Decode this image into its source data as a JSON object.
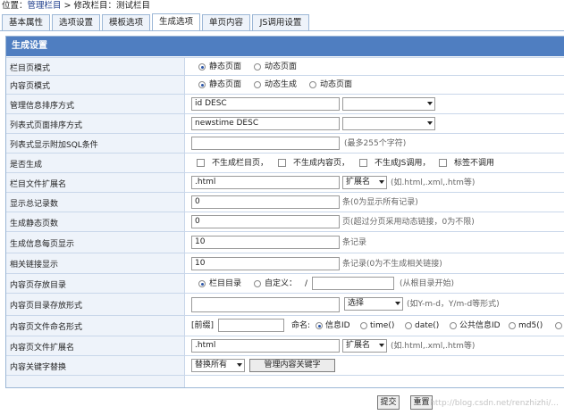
{
  "breadcrumb": {
    "prefix": "位置：",
    "link": "管理栏目",
    "sep": " > ",
    "current": "修改栏目：测试栏目"
  },
  "tabs": [
    "基本属性",
    "选项设置",
    "模板选项",
    "生成选项",
    "单页内容",
    "JS调用设置"
  ],
  "active_tab": "生成选项",
  "panel_title": "生成设置",
  "rows": {
    "list_mode": {
      "label": "栏目页模式",
      "opt1": "静态页面",
      "opt2": "动态页面",
      "selected": "静态页面"
    },
    "content_mode": {
      "label": "内容页模式",
      "opt1": "静态页面",
      "opt2": "动态生成",
      "opt3": "动态页面",
      "selected": "静态页面"
    },
    "admin_order": {
      "label": "管理信息排序方式",
      "value": "id DESC"
    },
    "list_order": {
      "label": "列表式页面排序方式",
      "value": "newstime DESC"
    },
    "list_sql": {
      "label": "列表式显示附加SQL条件",
      "value": "",
      "hint": "(最多255个字符)"
    },
    "gen_flags": {
      "label": "是否生成",
      "c1": "不生成栏目页，",
      "c2": "不生成内容页，",
      "c3": "不生成JS调用，",
      "c4": "标签不调用"
    },
    "list_ext": {
      "label": "栏目文件扩展名",
      "value": ".html",
      "select": "扩展名",
      "hint": "(如.html,.xml,.htm等)"
    },
    "total_records": {
      "label": "显示总记录数",
      "value": "0",
      "hint": "条(0为显示所有记录)"
    },
    "static_pages": {
      "label": "生成静态页数",
      "value": "0",
      "hint": "页(超过分页采用动态链接，0为不限)"
    },
    "per_page": {
      "label": "生成信息每页显示",
      "value": "10",
      "hint": "条记录"
    },
    "related": {
      "label": "相关链接显示",
      "value": "10",
      "hint": "条记录(0为不生成相关链接)"
    },
    "content_dir": {
      "label": "内容页存放目录",
      "opt1": "栏目目录",
      "opt2": "自定义：",
      "slash": "/",
      "value": "",
      "hint": "(从根目录开始)",
      "selected": "栏目目录"
    },
    "dir_format": {
      "label": "内容页目录存放形式",
      "value": "",
      "select": "选择",
      "hint": "(如Y-m-d，Y/m-d等形式)"
    },
    "file_naming": {
      "label": "内容页文件命名形式",
      "prefix_label": "[前缀]",
      "prefix_value": "",
      "name_label": "命名:",
      "o1": "信息ID",
      "o2": "time()",
      "o3": "date()",
      "o4": "公共信息ID",
      "o5": "md5()",
      "selected": "信息ID"
    },
    "content_ext": {
      "label": "内容页文件扩展名",
      "value": ".html",
      "select": "扩展名",
      "hint": "(如.html,.xml,.htm等)"
    },
    "keyword_replace": {
      "label": "内容关键字替换",
      "select": "替换所有",
      "button": "管理内容关键字"
    }
  },
  "submit_label": "提交",
  "reset_label": "重置",
  "watermark": "http://blog.csdn.net/renzhizhi/..."
}
